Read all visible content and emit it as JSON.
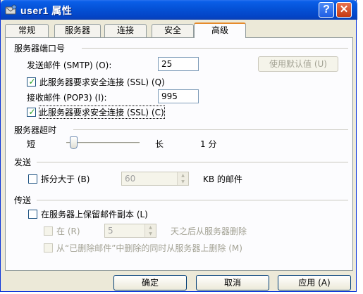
{
  "window": {
    "title": "user1 属性",
    "help_glyph": "?",
    "close_glyph": "✕"
  },
  "tabs": [
    {
      "label": "常规",
      "active": false
    },
    {
      "label": "服务器",
      "active": false
    },
    {
      "label": "连接",
      "active": false
    },
    {
      "label": "安全",
      "active": false
    },
    {
      "label": "高级",
      "active": true
    }
  ],
  "ports": {
    "section": "服务器端口号",
    "smtp_label": "发送邮件 (SMTP) (O):",
    "smtp_value": "25",
    "default_button": "使用默认值 (U)",
    "smtp_ssl_label": "此服务器要求安全连接 (SSL) (Q)",
    "smtp_ssl_checked": true,
    "pop3_label": "接收邮件 (POP3) (I):",
    "pop3_value": "995",
    "pop3_ssl_label": "此服务器要求安全连接 (SSL) (C)",
    "pop3_ssl_checked": true
  },
  "timeout": {
    "section": "服务器超时",
    "short_label": "短",
    "long_label": "长",
    "value_text": "1 分",
    "level_fraction": 0.05
  },
  "sending": {
    "section": "发送",
    "split_label": "拆分大于 (B)",
    "split_checked": false,
    "split_value": "60",
    "split_unit": "KB 的邮件"
  },
  "delivery": {
    "section": "传送",
    "keep_copy_label": "在服务器上保留邮件副本 (L)",
    "keep_copy_checked": false,
    "remove_after_label": "在 (R)",
    "remove_after_value": "5",
    "remove_after_unit": "天之后从服务器删除",
    "remove_deleted_label": "从“已删除邮件”中删除的同时从服务器上删除 (M)"
  },
  "footer": {
    "ok": "确定",
    "cancel": "取消",
    "apply": "应用 (A)"
  },
  "icons": {
    "window_icon": "user-account-icon",
    "spin_up": "▲",
    "spin_down": "▼",
    "check": "✓"
  }
}
